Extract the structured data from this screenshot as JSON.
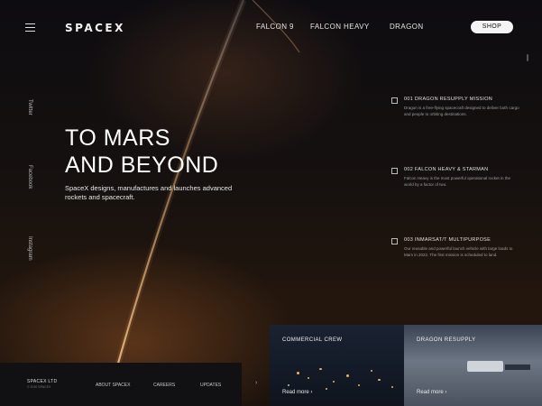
{
  "header": {
    "logo": "SPACEX",
    "nav": [
      "FALCON 9",
      "FALCON HEAVY",
      "DRAGON"
    ],
    "shop_label": "SHOP"
  },
  "side_links": [
    "Twitter",
    "Facebook",
    "Instagram"
  ],
  "hero": {
    "title_line1": "TO MARS",
    "title_line2": "AND BEYOND",
    "description": "SpaceX designs, manufactures and launches advanced rockets and spacecraft."
  },
  "missions": [
    {
      "title": "001 DRAGON RESUPPLY MISSION",
      "desc": "Dragon is a free-flying spacecraft designed to deliver both cargo and people to orbiting destinations."
    },
    {
      "title": "002 FALCON HEAVY & STARMAN",
      "desc": "Falcon Heavy is the most powerful operational rocket in the world by a factor of two."
    },
    {
      "title": "003 INMARSAT/T MULTIPURPOSE",
      "desc": "Our reusable and powerful launch vehicle with large loads to Mars in 2022. The first mission is scheduled to land."
    }
  ],
  "bottom_bar": {
    "logo": "SPACEX LTD",
    "sub": "© 2020 SPACEX",
    "items": [
      "ABOUT SPACEX",
      "CAREERS",
      "UPDATES"
    ]
  },
  "cards": [
    {
      "title": "COMMERCIAL CREW",
      "link": "Read more"
    },
    {
      "title": "DRAGON RESUPPLY",
      "link": "Read more"
    }
  ],
  "colors": {
    "accent_glow": "#f0b45a",
    "background": "#0b0b0e",
    "shop_button": "#f4f4f4"
  },
  "icons": [
    "menu-icon",
    "arrow-right-icon",
    "checkbox-icon"
  ]
}
